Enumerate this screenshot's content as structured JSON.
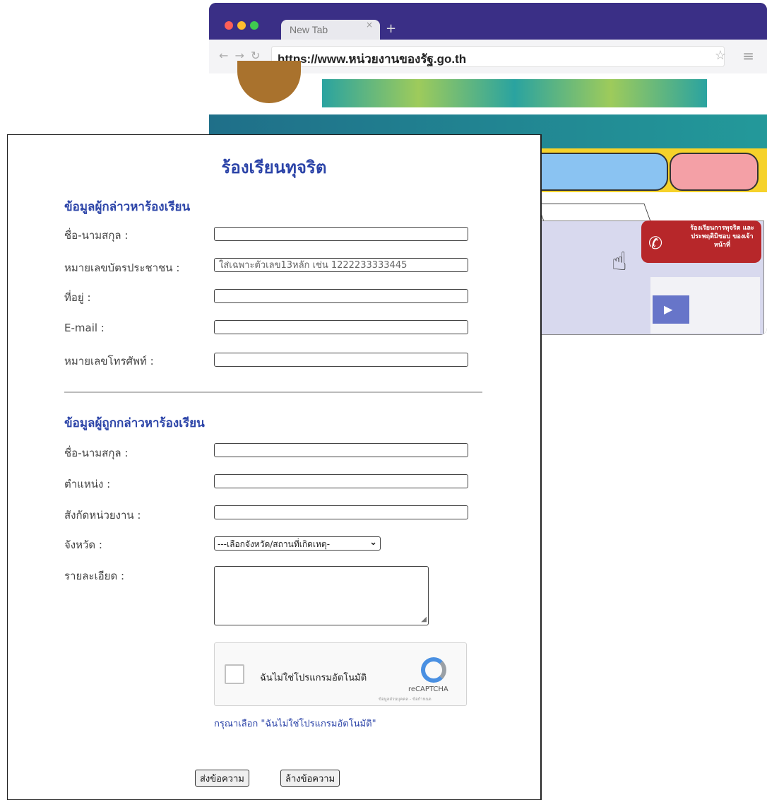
{
  "browser": {
    "tab_title": "New Tab",
    "tab_close": "×",
    "new_tab": "+",
    "url": "https://www.หน่วยงานของรัฐ.go.th",
    "badge_text": "ร้องเรียนการทุจริต และประพฤติมิชอบ ของเจ้าหน้าที่"
  },
  "form": {
    "title": "ร้องเรียนทุจริต",
    "complainant": {
      "section_title": "ข้อมูลผู้กล่าวหาร้องเรียน",
      "fields": [
        {
          "label": "ชื่อ-นามสกุล :",
          "value": "",
          "placeholder": ""
        },
        {
          "label": "หมายเลขบัตรประชาชน :",
          "value": "",
          "placeholder": "ใส่เฉพาะตัวเลข13หลัก เช่น 1222233333445"
        },
        {
          "label": "ที่อยู่ :",
          "value": "",
          "placeholder": ""
        },
        {
          "label": "E-mail :",
          "value": "",
          "placeholder": ""
        },
        {
          "label": "หมายเลขโทรศัพท์ :",
          "value": "",
          "placeholder": ""
        }
      ]
    },
    "accused": {
      "section_title": "ข้อมูลผู้ถูกกล่าวหาร้องเรียน",
      "fields": [
        {
          "label": "ชื่อ-นามสกุล :",
          "value": ""
        },
        {
          "label": "ตำแหน่ง :",
          "value": ""
        },
        {
          "label": "สังกัดหน่วยงาน :",
          "value": ""
        }
      ],
      "province_label": "จังหวัด :",
      "province_selected": "---เลือกจังหวัด/สถานที่เกิดเหตุ-",
      "detail_label": "รายละเอียด :",
      "detail_value": ""
    },
    "captcha": {
      "label": "ฉันไม่ใช่โปรแกรมอัตโนมัติ",
      "brand": "reCAPTCHA",
      "links": "ข้อมูลส่วนบุคคล - ข้อกำหนด"
    },
    "hint": "กรุณาเลือก \"ฉันไม่ใช่โปรแกรมอัตโนมัติ\"",
    "submit_label": "ส่งข้อความ",
    "reset_label": "ล้างข้อความ"
  }
}
